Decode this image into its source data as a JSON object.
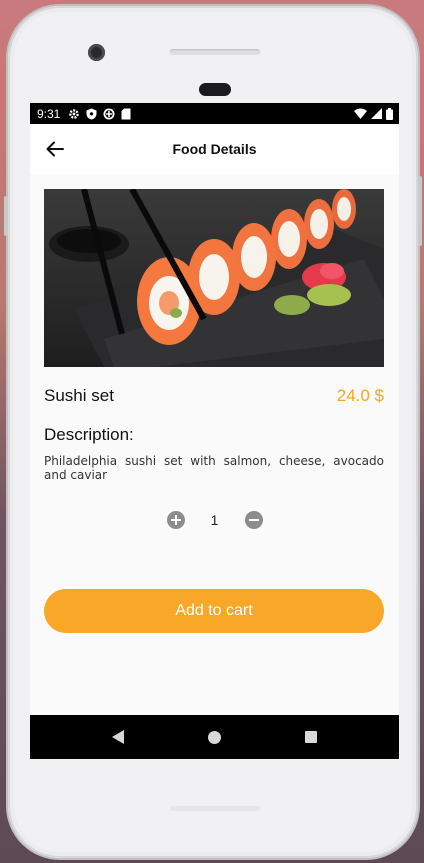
{
  "status_bar": {
    "time": "9:31"
  },
  "app_bar": {
    "title": "Food Details"
  },
  "food": {
    "name": "Sushi set",
    "price": "24.0 $",
    "description_title": "Description:",
    "description": "Philadelphia sushi set with salmon, cheese, avocado and caviar",
    "image_alt": "sushi-rolls-photo"
  },
  "quantity": {
    "value": "1"
  },
  "actions": {
    "add_to_cart": "Add to cart"
  },
  "colors": {
    "accent": "#f8a728",
    "price": "#f5a623",
    "bar": "#000000"
  }
}
